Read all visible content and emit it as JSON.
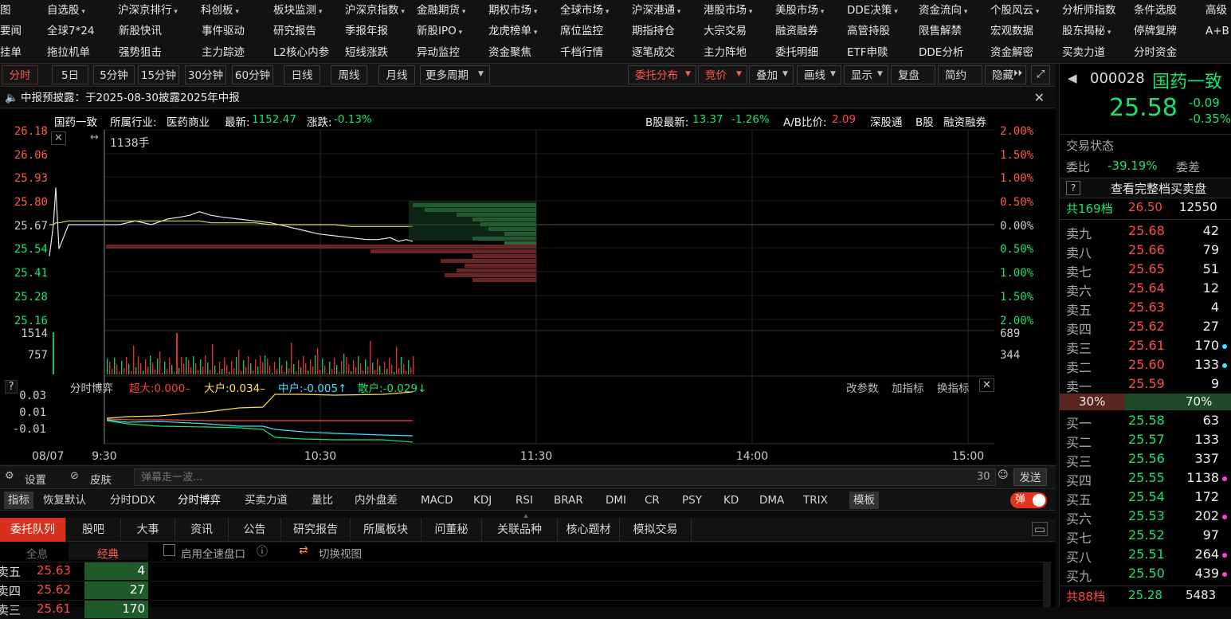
{
  "menu": {
    "row1": [
      "图",
      "自选股",
      "沪深京排行",
      "科创板",
      "板块监测",
      "沪深京指数",
      "金融期货",
      "期权市场",
      "全球市场",
      "沪深港通",
      "港股市场",
      "美股市场",
      "DDE决策",
      "资金流向",
      "个股风云",
      "分析师指数",
      "条件选股",
      "高级"
    ],
    "row2": [
      "要闻",
      "全球7*24",
      "新股快讯",
      "事件驱动",
      "研究报告",
      "季报年报",
      "新股IPO",
      "龙虎榜单",
      "席位监控",
      "期指持仓",
      "大宗交易",
      "融资融券",
      "高管持股",
      "限售解禁",
      "宏观数据",
      "股东揭秘",
      "停牌复牌",
      "A+B"
    ],
    "row3": [
      "挂单",
      "拖拉机单",
      "强势狙击",
      "主力踪迹",
      "L2核心内参",
      "短线涨跌",
      "异动监控",
      "资金聚焦",
      "千档行情",
      "逐笔成交",
      "主力阵地",
      "委托明细",
      "ETF申赎",
      "DDE分析",
      "资金解密",
      "买卖力道",
      "分时资金"
    ]
  },
  "toolbar": {
    "periods": [
      "分时",
      "5日",
      "5分钟",
      "15分钟",
      "30分钟",
      "60分钟",
      "日线",
      "周线",
      "月线",
      "更多周期"
    ],
    "right": [
      "委托分布",
      "竞价",
      "叠加",
      "画线",
      "显示",
      "复盘",
      "简约",
      "隐藏"
    ]
  },
  "notice": {
    "text": "中报预披露：于2025-08-30披露2025年中报"
  },
  "chart": {
    "stock_name": "国药一致",
    "industry_label": "所属行业:",
    "industry": "医药商业",
    "latest_label": "最新:",
    "latest": "1152.47",
    "change_label": "涨跌:",
    "change": "-0.13%",
    "b_latest_label": "B股最新:",
    "b_latest": "13.37",
    "b_change": "-1.26%",
    "ab_label": "A/B比价:",
    "ab_ratio": "2.09",
    "links": [
      "深股通",
      "B股",
      "融资融券"
    ],
    "cursor_label": "1138手",
    "price_ticks": [
      "26.18",
      "26.06",
      "25.93",
      "25.80",
      "25.67",
      "25.54",
      "25.41",
      "25.28",
      "25.16"
    ],
    "pct_ticks": [
      "2.00%",
      "1.50%",
      "1.00%",
      "0.50%",
      "0.00%",
      "0.50%",
      "1.00%",
      "1.50%",
      "2.00%"
    ],
    "vol_left": [
      "1514",
      "757"
    ],
    "vol_right": [
      "689",
      "344"
    ],
    "ind_name": "分时博弈",
    "ind_values": [
      {
        "label": "超大:0.000–",
        "color": "#ff4040"
      },
      {
        "label": "大户:0.034–",
        "color": "#ffe34a"
      },
      {
        "label": "中户:-0.005↑",
        "color": "#3fe0ff"
      },
      {
        "label": "散户:-0.029↓",
        "color": "#19e36b"
      }
    ],
    "ind_actions": [
      "改参数",
      "加指标",
      "换指标"
    ],
    "ind_ticks": [
      "0.03",
      "0.01",
      "-0.01"
    ],
    "date": "08/07",
    "times": [
      "9:30",
      "10:30",
      "11:30",
      "14:00",
      "15:00"
    ]
  },
  "chart_data": {
    "type": "line",
    "series": [
      {
        "name": "price",
        "values": [
          25.5,
          25.67,
          25.87,
          25.54,
          25.67,
          25.67,
          25.67,
          25.69,
          25.67,
          25.7,
          25.71,
          25.72,
          25.74,
          25.72,
          25.71,
          25.7,
          25.69,
          25.68,
          25.66,
          25.64,
          25.62,
          25.61,
          25.6,
          25.59,
          25.59,
          25.6,
          25.58,
          25.59,
          25.58
        ]
      },
      {
        "name": "avg",
        "values": [
          25.67,
          25.67,
          25.68,
          25.68,
          25.69,
          25.69,
          25.69,
          25.69,
          25.69,
          25.69,
          25.69,
          25.69,
          25.69,
          25.68,
          25.68,
          25.68,
          25.68,
          25.67,
          25.67,
          25.67,
          25.67,
          25.67,
          25.66,
          25.66,
          25.66,
          25.66,
          25.66,
          25.66,
          25.66
        ]
      }
    ]
  },
  "danmu": {
    "settings": "设置",
    "skin": "皮肤",
    "placeholder": "弹幕走一波...",
    "count": "30",
    "send": "发送"
  },
  "indicators": {
    "items": [
      "指标",
      "恢复默认",
      "分时DDX",
      "分时博弈",
      "买卖力道",
      "量比",
      "内外盘差",
      "MACD",
      "KDJ",
      "RSI",
      "BRAR",
      "DMI",
      "CR",
      "PSY",
      "KD",
      "DMA",
      "TRIX",
      "模板"
    ],
    "toggle": "弹"
  },
  "bottom_tabs": [
    "委托队列",
    "股吧",
    "大事",
    "资讯",
    "公告",
    "研究报告",
    "所属板块",
    "问董秘",
    "关联品种",
    "核心题材",
    "模拟交易"
  ],
  "queue": {
    "subtabs": [
      "全息",
      "经典"
    ],
    "fast_label": "启用全速盘口",
    "switch_label": "切换视图",
    "rows": [
      {
        "label": "卖五",
        "price": "25.63",
        "qty": "4"
      },
      {
        "label": "卖四",
        "price": "25.62",
        "qty": "27"
      },
      {
        "label": "卖三",
        "price": "25.61",
        "qty": "170"
      }
    ]
  },
  "quote": {
    "code": "000028",
    "name": "国药一致",
    "price": "25.58",
    "change": "-0.09",
    "change_pct": "-0.35%",
    "status_label": "交易状态",
    "ratio_label": "委比",
    "ratio": "-39.19%",
    "diff_label": "委差",
    "full_book": "查看完整档买卖盘",
    "total_sell_label": "共169档",
    "total_sell_price": "26.50",
    "total_sell_qty": "12550",
    "sells": [
      {
        "label": "卖九",
        "price": "25.68",
        "qty": "42",
        "color": "red"
      },
      {
        "label": "卖八",
        "price": "25.66",
        "qty": "79",
        "color": "red"
      },
      {
        "label": "卖七",
        "price": "25.65",
        "qty": "51",
        "color": "red"
      },
      {
        "label": "卖六",
        "price": "25.64",
        "qty": "12",
        "color": "red"
      },
      {
        "label": "卖五",
        "price": "25.63",
        "qty": "4",
        "color": "red"
      },
      {
        "label": "卖四",
        "price": "25.62",
        "qty": "27",
        "color": "red"
      },
      {
        "label": "卖三",
        "price": "25.61",
        "qty": "170",
        "color": "red"
      },
      {
        "label": "卖二",
        "price": "25.60",
        "qty": "133",
        "color": "red"
      },
      {
        "label": "卖一",
        "price": "25.59",
        "qty": "9",
        "color": "red"
      }
    ],
    "sell_pct": "30%",
    "buy_pct": "70%",
    "buys": [
      {
        "label": "买一",
        "price": "25.58",
        "qty": "63"
      },
      {
        "label": "买二",
        "price": "25.57",
        "qty": "133"
      },
      {
        "label": "买三",
        "price": "25.56",
        "qty": "337"
      },
      {
        "label": "买四",
        "price": "25.55",
        "qty": "1138"
      },
      {
        "label": "买五",
        "price": "25.54",
        "qty": "172"
      },
      {
        "label": "买六",
        "price": "25.53",
        "qty": "202"
      },
      {
        "label": "买七",
        "price": "25.52",
        "qty": "97"
      },
      {
        "label": "买八",
        "price": "25.51",
        "qty": "264"
      },
      {
        "label": "买九",
        "price": "25.50",
        "qty": "439"
      }
    ],
    "total_buy_label": "共88档",
    "total_buy_price": "25.28",
    "total_buy_qty": "5483"
  }
}
